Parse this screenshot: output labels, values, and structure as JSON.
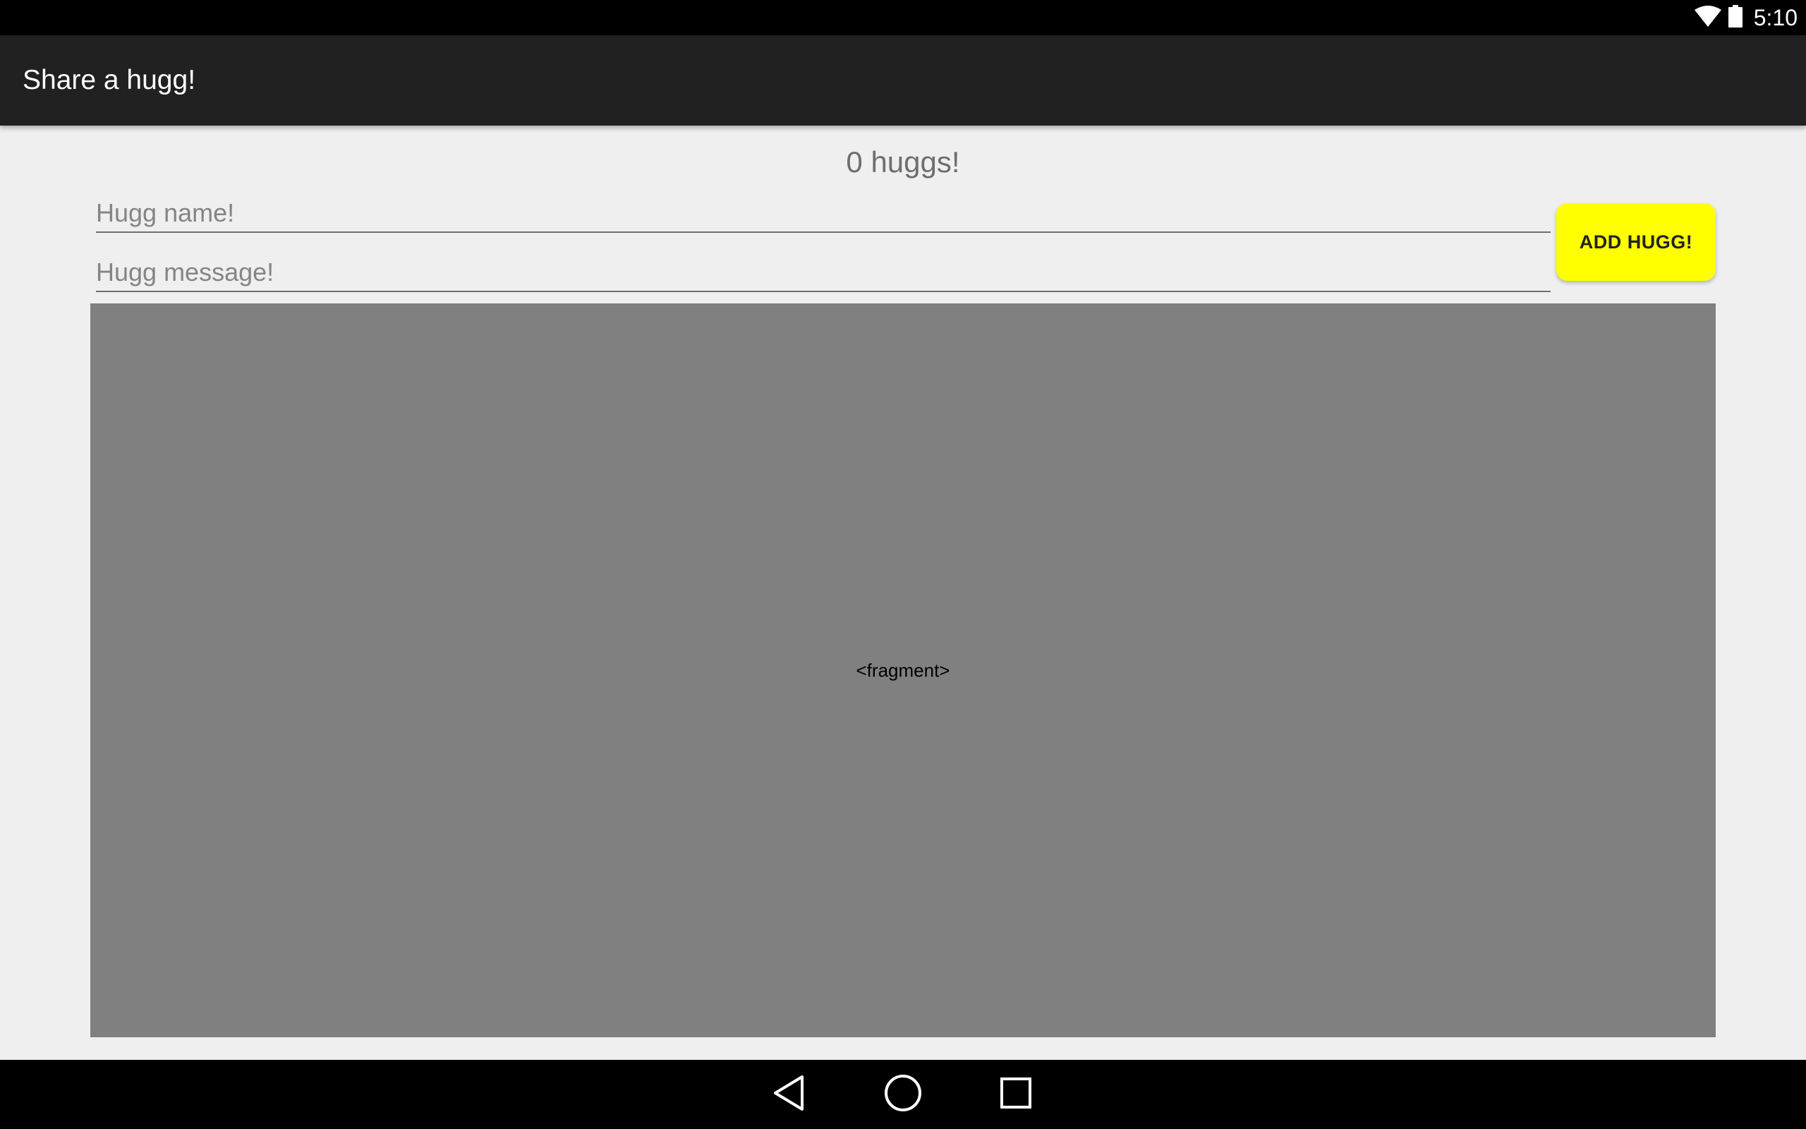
{
  "status_bar": {
    "time": "5:10",
    "icons": [
      "wifi-icon",
      "battery-icon"
    ]
  },
  "app_bar": {
    "title": "Share a hugg!"
  },
  "main": {
    "count_text": "0 huggs!",
    "name_field": {
      "placeholder": "Hugg name!",
      "value": ""
    },
    "message_field": {
      "placeholder": "Hugg message!",
      "value": ""
    },
    "add_button_label": "ADD HUGG!",
    "fragment_label": "<fragment>"
  },
  "nav_bar": {
    "buttons": [
      "back-icon",
      "home-icon",
      "recents-icon"
    ]
  },
  "colors": {
    "accent_button": "#ffff00",
    "app_bar": "#212121",
    "background": "#efefef",
    "fragment": "#808080"
  }
}
